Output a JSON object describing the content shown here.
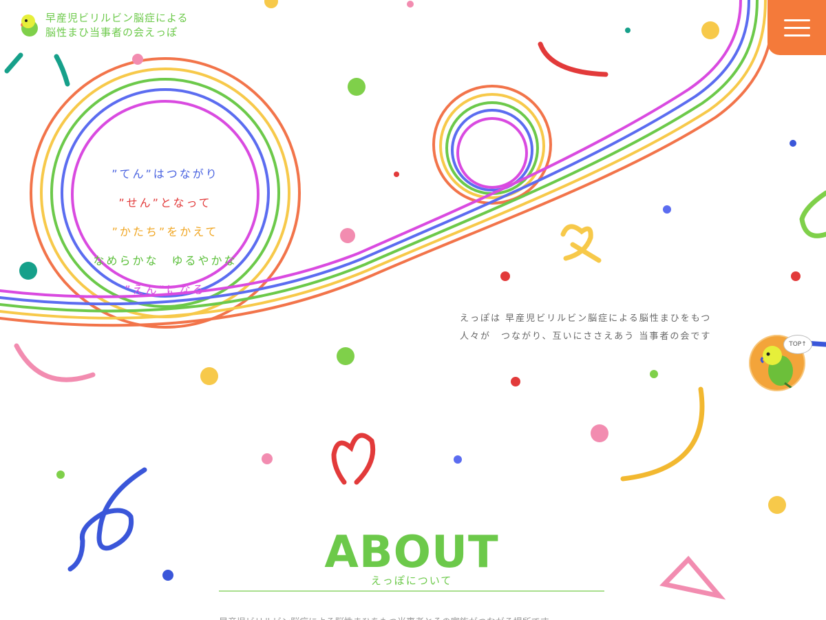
{
  "site": {
    "logo_line1": "早産児ビリルビン脳症による",
    "logo_line2": "脳性まひ当事者の会えっぽ",
    "logo_icon": "parakeet-icon",
    "menu_icon": "hamburger-menu-icon"
  },
  "hero": {
    "poem": [
      {
        "text": "”てん”はつながり",
        "color": "#4a63e0"
      },
      {
        "text": "”せん”となって",
        "color": "#e23a3a"
      },
      {
        "text": "”かたち”をかえて",
        "color": "#f0a520"
      },
      {
        "text": "なめらかな　ゆるやかな",
        "color": "#5bbf3a"
      },
      {
        "text": "”えん”になる",
        "color": "#d94ae0"
      }
    ],
    "tagline_line1": "えっぽは 早産児ビリルビン脳症による脳性まひをもつ",
    "tagline_line2": "人々が　つながり、互いにささえあう 当事者の会です"
  },
  "top_button": {
    "label": "TOP↑",
    "icon": "parakeet-icon"
  },
  "about": {
    "heading": "ABOUT",
    "subheading": "えっぽについて",
    "text": "早産児ビリルビン脳症による脳性まひをもつ当事者とその家族がつながる場所です。"
  },
  "colors": {
    "accent_green": "#6cc94a",
    "menu_orange": "#f47a3a",
    "rainbow": [
      "#f2744a",
      "#f7c94a",
      "#6cc94a",
      "#5b6cf0",
      "#d94ae0"
    ]
  }
}
